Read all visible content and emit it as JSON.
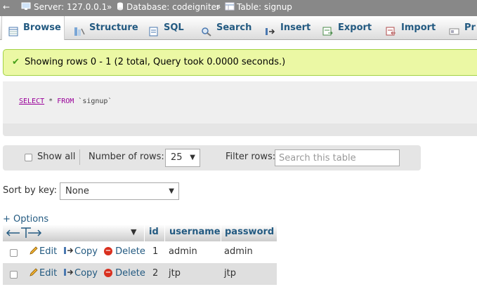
{
  "breadcrumb": {
    "back_arrow": "←",
    "server": "Server: 127.0.0.1",
    "sep1": "»",
    "database": "Database: codeigniter",
    "sep2": "»",
    "table": "Table: signup"
  },
  "tabs": [
    {
      "label": "Browse",
      "icon": "browse-icon",
      "active": true
    },
    {
      "label": "Structure",
      "icon": "structure-icon"
    },
    {
      "label": "SQL",
      "icon": "sql-icon"
    },
    {
      "label": "Search",
      "icon": "search-icon"
    },
    {
      "label": "Insert",
      "icon": "insert-icon"
    },
    {
      "label": "Export",
      "icon": "export-icon"
    },
    {
      "label": "Import",
      "icon": "import-icon"
    },
    {
      "label": "Pr",
      "icon": "privileges-icon"
    }
  ],
  "message": {
    "text": "Showing rows 0 - 1 (2 total, Query took 0.0000 seconds.)",
    "color": "#ebf8a4"
  },
  "query": {
    "select": "SELECT",
    "star": " * ",
    "from": "FROM",
    "table": " `signup`"
  },
  "nav": {
    "show_all_label": "Show all",
    "rows_label": "Number of rows:",
    "rows_value": "25",
    "filter_label": "Filter rows:",
    "filter_placeholder": "Search this table"
  },
  "sort": {
    "label": "Sort by key:",
    "value": "None"
  },
  "options_link": "+ Options",
  "table": {
    "columns": [
      "id",
      "username",
      "password"
    ],
    "action_labels": {
      "edit": "Edit",
      "copy": "Copy",
      "delete": "Delete"
    },
    "rows": [
      {
        "id": "1",
        "username": "admin",
        "password": "admin"
      },
      {
        "id": "2",
        "username": "jtp",
        "password": "jtp"
      }
    ]
  },
  "colors": {
    "link": "#235a81",
    "header_bar": "#888888",
    "success_border": "#a2d246",
    "delete": "#d9301f"
  }
}
